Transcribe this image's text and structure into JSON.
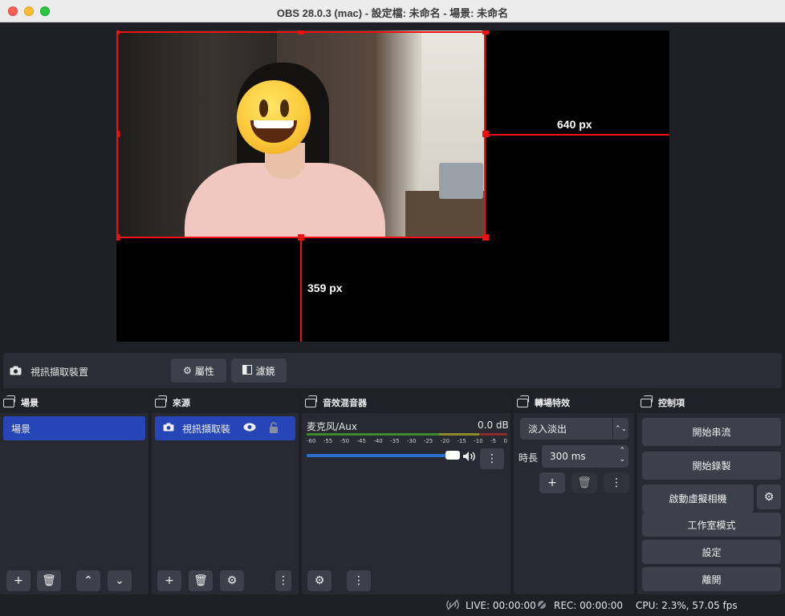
{
  "window": {
    "title": "OBS 28.0.3 (mac) - 設定檔: 未命名 - 場景: 未命名"
  },
  "preview": {
    "guide_width_label": "640 px",
    "guide_height_label": "359 px"
  },
  "source_toolbar": {
    "source_name": "視訊擷取裝置",
    "properties_label": "屬性",
    "filters_label": "濾鏡"
  },
  "docks": {
    "scenes": {
      "title": "場景",
      "items": [
        "場景"
      ]
    },
    "sources": {
      "title": "來源",
      "items": [
        "視訊擷取裝"
      ]
    },
    "mixer": {
      "title": "音效混音器",
      "channel_name": "麦克风/Aux",
      "level": "0.0 dB",
      "ticks": [
        "-60",
        "-55",
        "-50",
        "-45",
        "-40",
        "-35",
        "-30",
        "-25",
        "-20",
        "-15",
        "-10",
        "-5",
        "0"
      ],
      "volume": 1.0
    },
    "transitions": {
      "title": "轉場特效",
      "selected": "淡入淡出",
      "duration_label": "時長",
      "duration_value": "300 ms"
    },
    "controls": {
      "title": "控制項",
      "start_stream": "開始串流",
      "start_record": "開始錄製",
      "start_virtualcam": "啟動虛擬相機",
      "studio_mode": "工作室模式",
      "settings": "設定",
      "exit": "離開"
    }
  },
  "status_bar": {
    "live": "LIVE: 00:00:00",
    "rec": "REC: 00:00:00",
    "cpu": "CPU: 2.3%, 57.05 fps"
  },
  "colors": {
    "selection": "#ee1111",
    "accent": "#2646b7",
    "slider": "#2a6fd1"
  }
}
